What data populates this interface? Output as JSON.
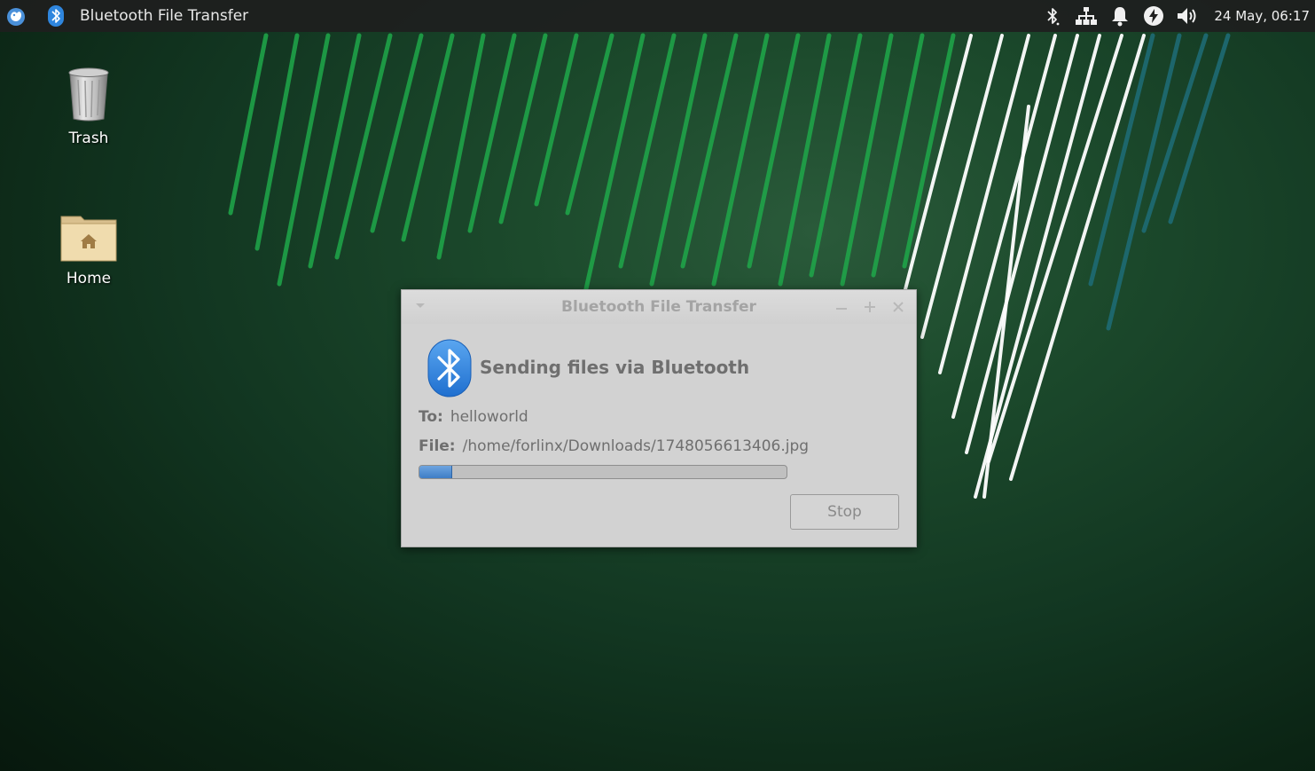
{
  "panel": {
    "task_label": "Bluetooth File Transfer",
    "clock": "24 May, 06:17",
    "tray_icons": [
      "bluetooth-icon",
      "network-icon",
      "notification-bell-icon",
      "power-icon",
      "volume-icon"
    ]
  },
  "desktop": {
    "icons": [
      {
        "label": "Trash",
        "icon": "trash-icon"
      },
      {
        "label": "Home",
        "icon": "home-folder-icon"
      }
    ]
  },
  "dialog": {
    "title": "Bluetooth File Transfer",
    "heading": "Sending files via Bluetooth",
    "to_label": "To:",
    "to_value": "helloworld",
    "file_label": "File:",
    "file_value": "/home/forlinx/Downloads/1748056613406.jpg",
    "progress_fraction": 0.09,
    "stop_label": "Stop"
  },
  "colors": {
    "panel_bg": "#1e1e1e",
    "dialog_bg": "#d2d2d2",
    "bluetooth_blue": "#2f86de",
    "progress_fill": "#4d8bd4",
    "stripe_green": "#1fa84a",
    "stripe_white": "#ffffff",
    "stripe_teal": "#1e6b74"
  }
}
